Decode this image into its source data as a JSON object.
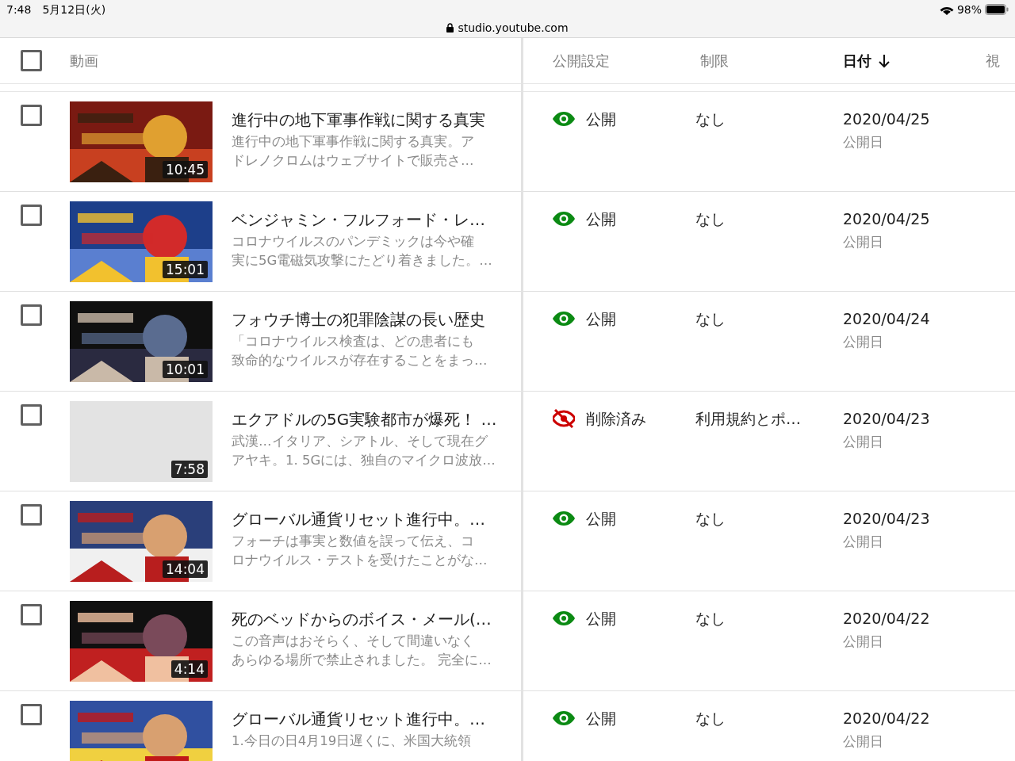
{
  "status_bar": {
    "time": "7:48",
    "date": "5月12日(火)",
    "battery": "98%"
  },
  "address_bar": {
    "url": "studio.youtube.com"
  },
  "table": {
    "select_all": {
      "checked": false
    },
    "columns": [
      {
        "label": "動画",
        "sorted": false
      },
      {
        "label": "公開設定",
        "sorted": false
      },
      {
        "label": "制限",
        "sorted": false
      },
      {
        "label": "日付",
        "sorted": true
      },
      {
        "label": "視",
        "sorted": false
      }
    ],
    "rows": [
      {
        "checked": false,
        "thumbnail": {
          "kind": "picture"
        },
        "duration": "10:45",
        "title": "進行中の地下軍事作戦に関する真実",
        "description": [
          "進行中の地下軍事作戦に関する真実。ア",
          "ドレノクロムはウェブサイトで販売さ…"
        ],
        "visibility": {
          "kind": "public",
          "label": "公開"
        },
        "restriction": "なし",
        "date": "2020/04/25",
        "date_label": "公開日"
      },
      {
        "checked": false,
        "thumbnail": {
          "kind": "picture"
        },
        "duration": "15:01",
        "title": "ベンジャミン・フルフォード・レ…",
        "description": [
          "コロナウイルスのパンデミックは今や確",
          "実に5G電磁気攻撃にたどり着きました。…"
        ],
        "visibility": {
          "kind": "public",
          "label": "公開"
        },
        "restriction": "なし",
        "date": "2020/04/25",
        "date_label": "公開日"
      },
      {
        "checked": false,
        "thumbnail": {
          "kind": "picture"
        },
        "duration": "10:01",
        "title": "フォウチ博士の犯罪陰謀の長い歴史",
        "description": [
          "「コロナウイルス検査は、どの患者にも",
          "致命的なウイルスが存在することをまっ…"
        ],
        "visibility": {
          "kind": "public",
          "label": "公開"
        },
        "restriction": "なし",
        "date": "2020/04/24",
        "date_label": "公開日"
      },
      {
        "checked": false,
        "thumbnail": {
          "kind": "blank"
        },
        "duration": "7:58",
        "title": "エクアドルの5G実験都市が爆死！ …",
        "description": [
          "武漢…イタリア、シアトル、そして現在グ",
          "アヤキ。1. 5Gには、独自のマイクロ波放…"
        ],
        "visibility": {
          "kind": "removed",
          "label": "削除済み"
        },
        "restriction": "利用規約とポ…",
        "date": "2020/04/23",
        "date_label": "公開日"
      },
      {
        "checked": false,
        "thumbnail": {
          "kind": "picture"
        },
        "duration": "14:04",
        "title": "グローバル通貨リセット進行中。…",
        "description": [
          "フォーチは事実と数値を誤って伝え、コ",
          "ロナウイルス・テストを受けたことがな…"
        ],
        "visibility": {
          "kind": "public",
          "label": "公開"
        },
        "restriction": "なし",
        "date": "2020/04/23",
        "date_label": "公開日"
      },
      {
        "checked": false,
        "thumbnail": {
          "kind": "picture"
        },
        "duration": "4:14",
        "title": "死のベッドからのボイス・メール(…",
        "description": [
          "この音声はおそらく、そして間違いなく",
          "あらゆる場所で禁止されました。 完全に…"
        ],
        "visibility": {
          "kind": "public",
          "label": "公開"
        },
        "restriction": "なし",
        "date": "2020/04/22",
        "date_label": "公開日"
      },
      {
        "checked": false,
        "thumbnail": {
          "kind": "picture"
        },
        "title": "グローバル通貨リセット進行中。…",
        "description": [
          "1.今日の日4月19日遅くに、米国大統領"
        ],
        "visibility": {
          "kind": "public",
          "label": "公開"
        },
        "restriction": "なし",
        "date": "2020/04/22",
        "date_label": "公開日"
      }
    ]
  }
}
